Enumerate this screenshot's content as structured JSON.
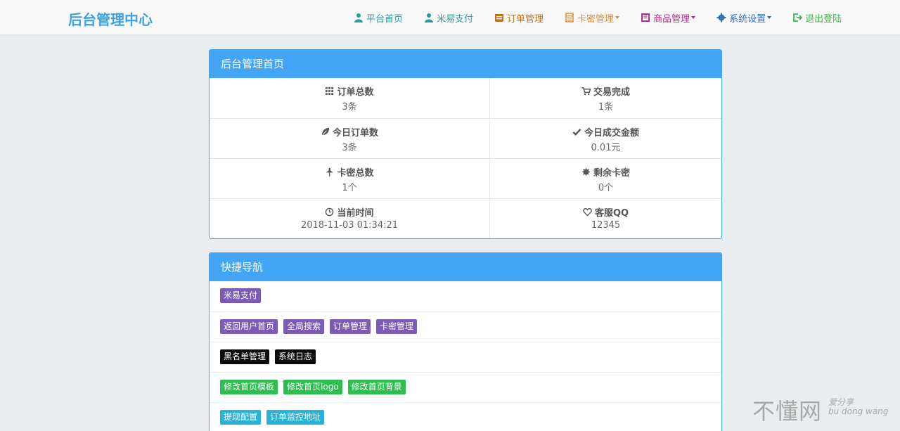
{
  "brand": "后台管理中心",
  "nav": [
    {
      "label": "平台首页",
      "color": "#2a9d9b",
      "icon": "user-icon",
      "caret": false
    },
    {
      "label": "米易支付",
      "color": "#2a9d9b",
      "icon": "user-icon",
      "caret": false
    },
    {
      "label": "订单管理",
      "color": "#c0711b",
      "icon": "list-icon",
      "caret": false
    },
    {
      "label": "卡密管理",
      "color": "#e08a2a",
      "icon": "card-icon",
      "caret": true
    },
    {
      "label": "商品管理",
      "color": "#c8238f",
      "icon": "goods-icon",
      "caret": true
    },
    {
      "label": "系统设置",
      "color": "#2c6fb7",
      "icon": "gear-icon",
      "caret": true
    },
    {
      "label": "退出登陆",
      "color": "#3bb54a",
      "icon": "logout-icon",
      "caret": false
    }
  ],
  "dashboard": {
    "title": "后台管理首页",
    "rows": [
      [
        {
          "label": "订单总数",
          "value": "3条",
          "icon": "grid-icon"
        },
        {
          "label": "交易完成",
          "value": "1条",
          "icon": "cart-icon"
        }
      ],
      [
        {
          "label": "今日订单数",
          "value": "3条",
          "icon": "leaf-icon"
        },
        {
          "label": "今日成交金额",
          "value": "0.01元",
          "icon": "check-icon"
        }
      ],
      [
        {
          "label": "卡密总数",
          "value": "1个",
          "icon": "pushpin-icon"
        },
        {
          "label": "剩余卡密",
          "value": "0个",
          "icon": "certificate-icon"
        }
      ],
      [
        {
          "label": "当前时间",
          "value": "2018-11-03 01:34:21",
          "icon": "clock-icon"
        },
        {
          "label": "客服QQ",
          "value": "12345",
          "icon": "heart-icon"
        }
      ]
    ]
  },
  "shortcuts": {
    "title": "快捷导航",
    "rows": [
      {
        "color": "#7a5bb5",
        "items": [
          "米易支付"
        ]
      },
      {
        "color": "#7a5bb5",
        "items": [
          "返回用户首页",
          "全局搜索",
          "订单管理",
          "卡密管理"
        ]
      },
      {
        "color": "#0b0b0b",
        "items": [
          "黑名单管理",
          "系统日志"
        ]
      },
      {
        "color": "#2ebd4f",
        "items": [
          "修改首页模板",
          "修改首页logo",
          "修改首页背景"
        ]
      },
      {
        "color": "#29b1d6",
        "items": [
          "提现配置",
          "订单监控地址"
        ]
      }
    ]
  },
  "watermark": {
    "main": "不懂网",
    "sub": "爱分享",
    "pinyin": "bu dong wang"
  }
}
